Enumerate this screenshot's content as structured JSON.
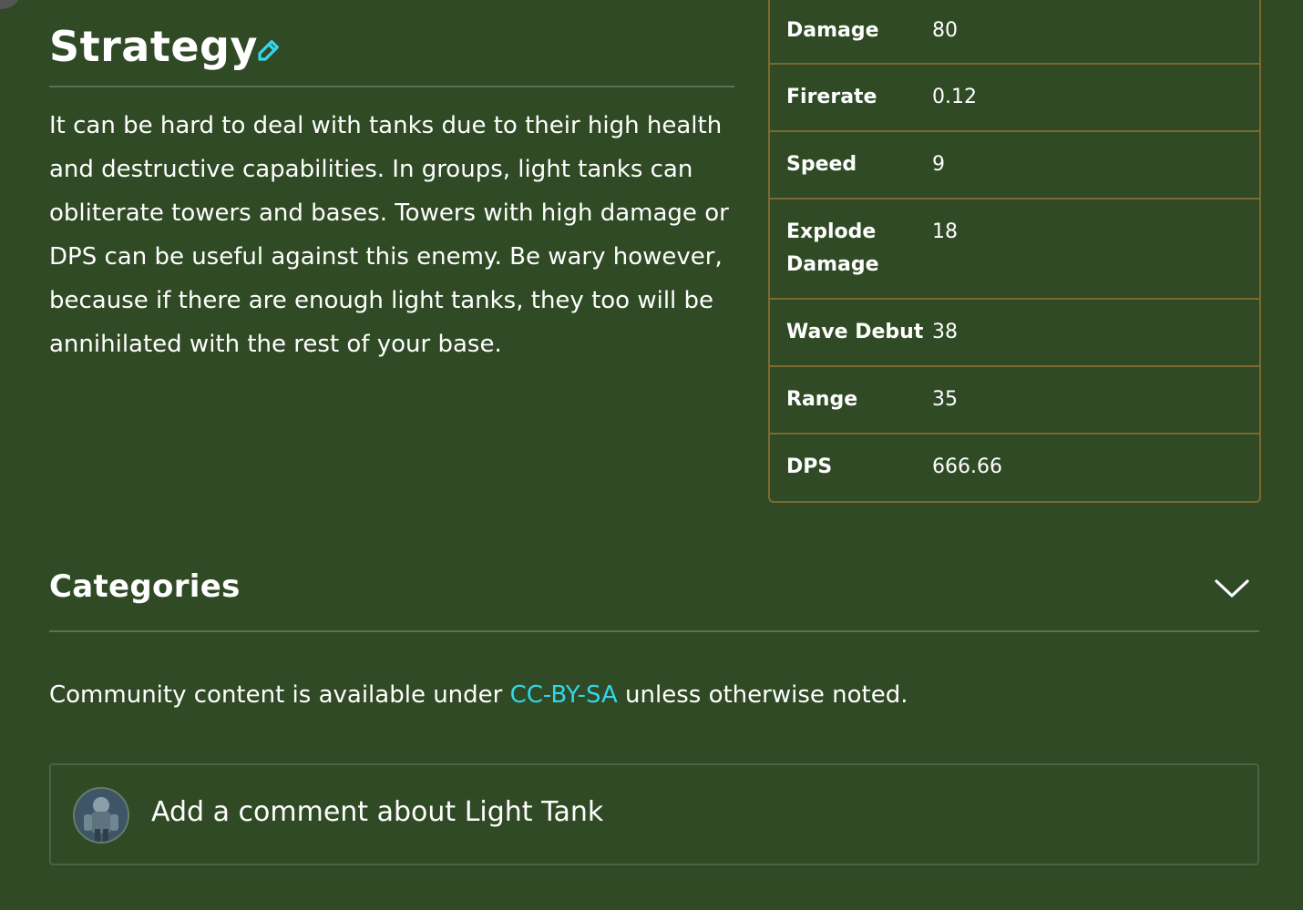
{
  "strategy": {
    "title": "Strategy",
    "body": "It can be hard to deal with tanks due to their high health and destructive capabilities. In groups, light tanks can obliterate towers and bases. Towers with high damage or DPS can be useful against this enemy. Be wary however, because if there are enough light tanks, they too will be annihilated with the rest of your base."
  },
  "stats": [
    {
      "label": "Damage",
      "value": "80"
    },
    {
      "label": "Firerate",
      "value": "0.12"
    },
    {
      "label": "Speed",
      "value": "9"
    },
    {
      "label": "Explode Damage",
      "value": "18"
    },
    {
      "label": "Wave Debut",
      "value": "38"
    },
    {
      "label": "Range",
      "value": "35"
    },
    {
      "label": "DPS",
      "value": "666.66"
    }
  ],
  "categories": {
    "title": "Categories"
  },
  "license": {
    "prefix": "Community content is available under ",
    "link": "CC-BY-SA",
    "suffix": " unless otherwise noted."
  },
  "comment": {
    "prompt": "Add a comment about Light Tank"
  },
  "colors": {
    "background": "#2f4a24",
    "link": "#33d6ea",
    "table_border": "#7c6a2e"
  },
  "icons": {
    "edit": "pencil-icon",
    "expand": "chevron-down-icon"
  }
}
